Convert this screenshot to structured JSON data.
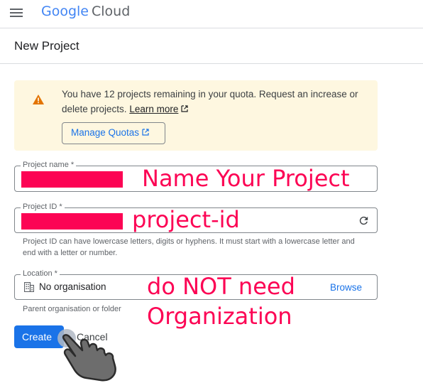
{
  "header": {
    "logo_google": "Google",
    "logo_cloud": "Cloud"
  },
  "page": {
    "title": "New Project"
  },
  "alert": {
    "message": "You have 12 projects remaining in your quota. Request an increase or delete projects.",
    "learn_more": "Learn more",
    "manage_quotas": "Manage Quotas",
    "icon": "warning-icon",
    "background": "#fef7e0",
    "icon_color": "#e37400"
  },
  "form": {
    "project_name": {
      "label": "Project name *"
    },
    "project_id": {
      "label": "Project ID *",
      "helper": "Project ID can have lowercase letters, digits or hyphens. It must start with a lowercase letter and end with a letter or number.",
      "refresh_icon": "refresh-icon"
    },
    "location": {
      "label": "Location *",
      "value": "No organisation",
      "browse": "Browse",
      "helper": "Parent organisation or folder",
      "icon": "building-icon"
    }
  },
  "annotations": {
    "name": "Name Your Project",
    "id": "project-id",
    "org_line1": "do NOT need",
    "org_line2": "Organization",
    "color": "#fc0454"
  },
  "actions": {
    "create": "Create",
    "cancel": "Cancel"
  },
  "colors": {
    "accent": "#1a73e8",
    "redaction": "#fc0454"
  }
}
